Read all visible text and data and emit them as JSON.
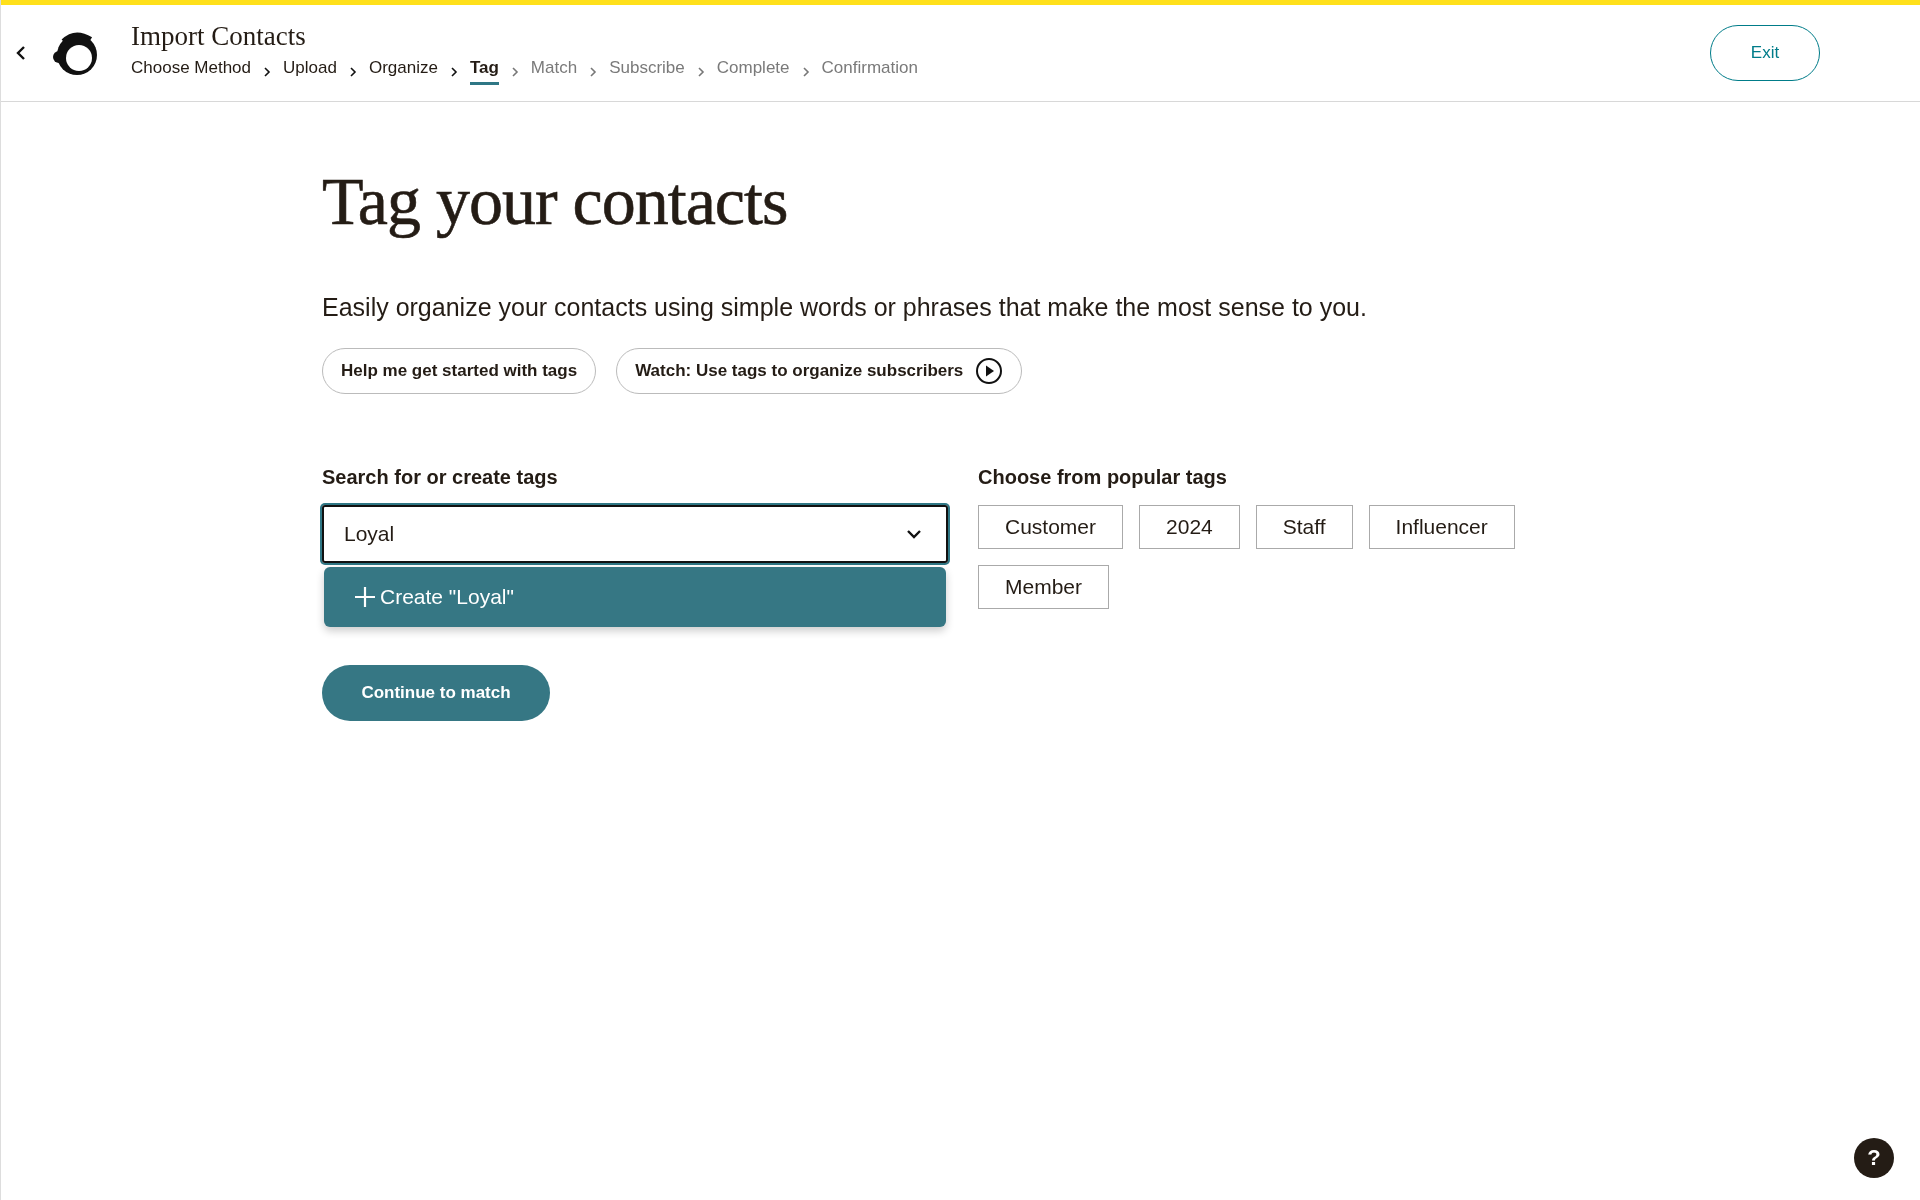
{
  "header": {
    "title": "Import Contacts",
    "steps": [
      {
        "label": "Choose Method",
        "completed": true,
        "selected": false
      },
      {
        "label": "Upload",
        "completed": true,
        "selected": false
      },
      {
        "label": "Organize",
        "completed": true,
        "selected": false
      },
      {
        "label": "Tag",
        "completed": false,
        "selected": true
      },
      {
        "label": "Match",
        "completed": false,
        "selected": false
      },
      {
        "label": "Subscribe",
        "completed": false,
        "selected": false
      },
      {
        "label": "Complete",
        "completed": false,
        "selected": false
      },
      {
        "label": "Confirmation",
        "completed": false,
        "selected": false
      }
    ],
    "exit": "Exit"
  },
  "heading": "Tag your contacts",
  "description": "Easily organize your contacts using simple words or phrases that make the most sense to you.",
  "help_buttons": [
    {
      "label": "Help me get started with tags",
      "kind": "plain"
    },
    {
      "label": "Watch: Use tags to organize subscribers",
      "kind": "video"
    }
  ],
  "search": {
    "label": "Search for or create tags",
    "value": "Loyal",
    "option": "Create \"Loyal\""
  },
  "popular": {
    "label": "Choose from popular tags",
    "tags": [
      "Customer",
      "2024",
      "Staff",
      "Influencer",
      "Member"
    ]
  },
  "continue": "Continue to match",
  "help_fab": "?"
}
